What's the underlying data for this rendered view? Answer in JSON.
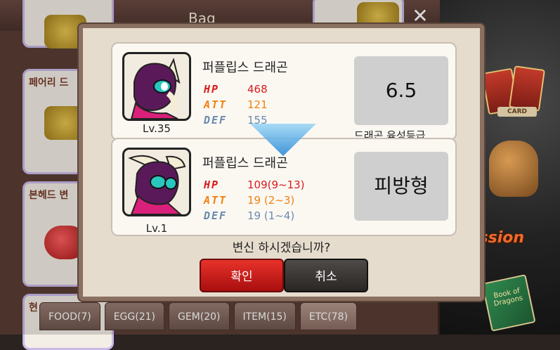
{
  "bag": {
    "title": "Bag",
    "close_symbol": "✕",
    "list_items": [
      {
        "label": "",
        "badge": ""
      },
      {
        "label": "페어리 드",
        "badge": ""
      },
      {
        "label": "본헤드 변",
        "badge": ""
      },
      {
        "label": "현",
        "badge": ""
      }
    ],
    "tabs": [
      {
        "label": "FOOD(7)"
      },
      {
        "label": "EGG(21)"
      },
      {
        "label": "GEM(20)"
      },
      {
        "label": "ITEM(15)"
      },
      {
        "label": "ETC(78)"
      }
    ]
  },
  "background": {
    "card_text": "CARD",
    "mission_text": "ission",
    "book_text": "Book of Dragons"
  },
  "modal": {
    "current": {
      "name": "퍼플립스 드래곤",
      "level": "Lv.35",
      "stats": {
        "hp_label": "HP",
        "hp": "468",
        "att_label": "ATT",
        "att": "121",
        "def_label": "DEF",
        "def": "155"
      },
      "grade_value": "6.5",
      "grade_caption": "드래곤 육성등급"
    },
    "result": {
      "name": "퍼플립스 드래곤",
      "level": "Lv.1",
      "stats": {
        "hp_label": "HP",
        "hp": "109(9~13)",
        "att_label": "ATT",
        "att": "19 (2~3)",
        "def_label": "DEF",
        "def": "19 (1~4)"
      },
      "type_value": "피방형"
    },
    "question": "변신 하시겠습니까?",
    "confirm_label": "확인",
    "cancel_label": "취소"
  },
  "colors": {
    "hp": "#d81b1b",
    "att": "#f08010",
    "def": "#6a8ab0",
    "confirm": "#d8201a",
    "cancel": "#3a3634"
  }
}
